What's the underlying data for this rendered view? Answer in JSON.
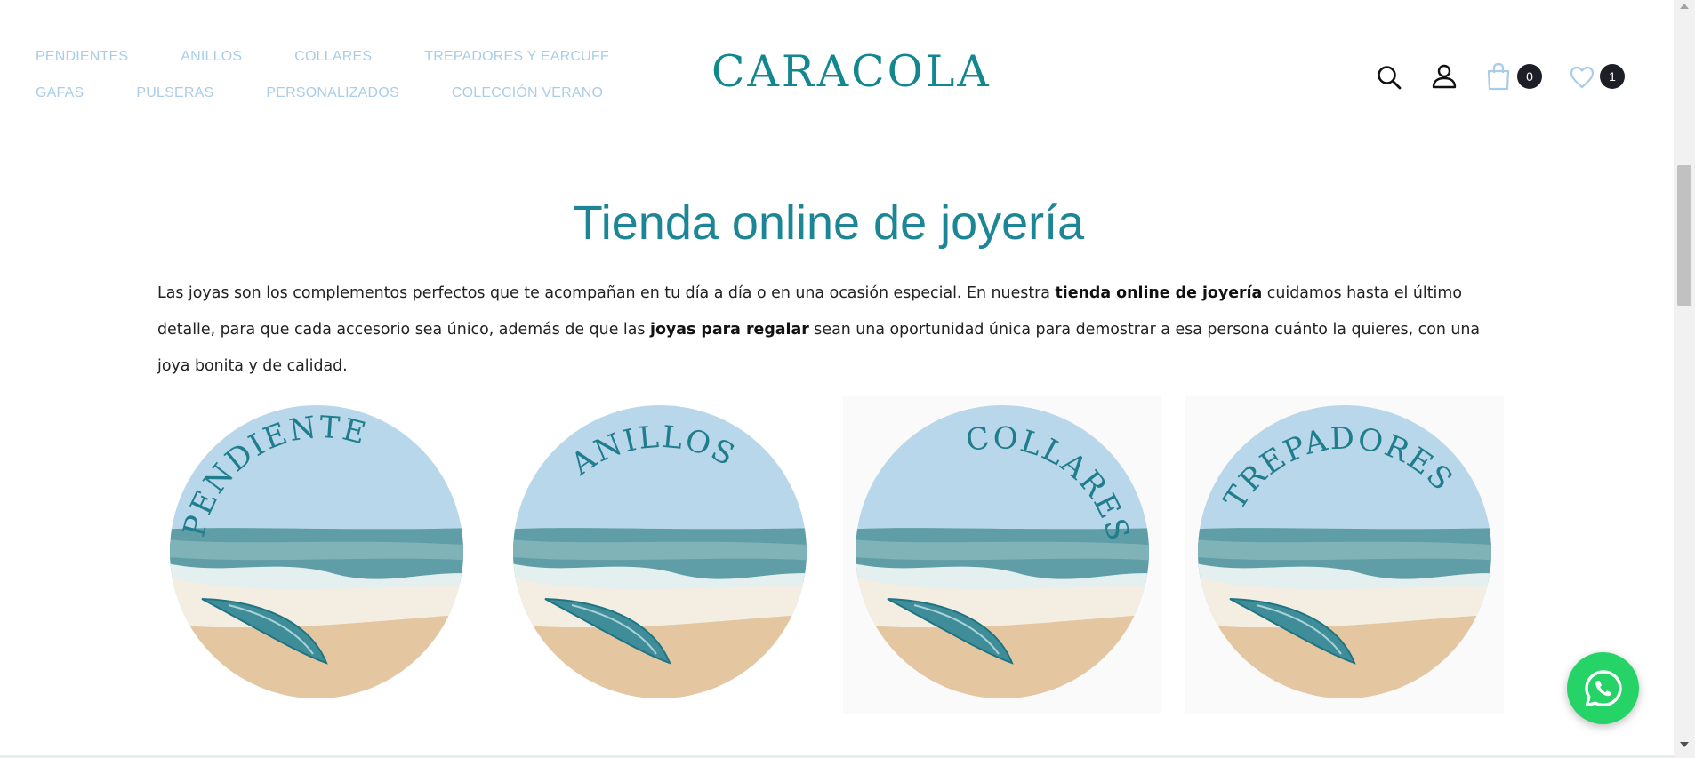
{
  "header": {
    "nav_row1": [
      "PENDIENTES",
      "ANILLOS",
      "COLLARES",
      "TREPADORES Y EARCUFF"
    ],
    "nav_row2": [
      "GAFAS",
      "PULSERAS",
      "PERSONALIZADOS",
      "COLECCIÓN VERANO"
    ],
    "logo": "CARACOLA",
    "icons": [
      "search-icon",
      "user-icon",
      "shopping-bag-icon",
      "heart-icon"
    ],
    "cart_count": "0",
    "wishlist_count": "1",
    "nav_color": "#a9cde8",
    "brand_color": "#138790"
  },
  "main": {
    "title": "Tienda online de joyería",
    "intro": {
      "part1": "Las joyas son los complementos perfectos que te acompañan en tu día a día o en una ocasión especial. En nuestra ",
      "bold1": "tienda online de joyería",
      "part2": " cuidamos hasta el último detalle, para que cada accesorio sea único, además de que las ",
      "bold2": "joyas para regalar",
      "part3": " sean una oportunidad única para demostrar a esa persona cuánto la quieres, con una joya bonita y de calidad."
    },
    "categories": [
      {
        "label": "PENDIENTES"
      },
      {
        "label": "ANILLOS"
      },
      {
        "label": "COLLARES"
      },
      {
        "label": "TREPADORES"
      }
    ]
  },
  "whatsapp": {
    "icon": "whatsapp-icon",
    "color": "#25d366"
  }
}
